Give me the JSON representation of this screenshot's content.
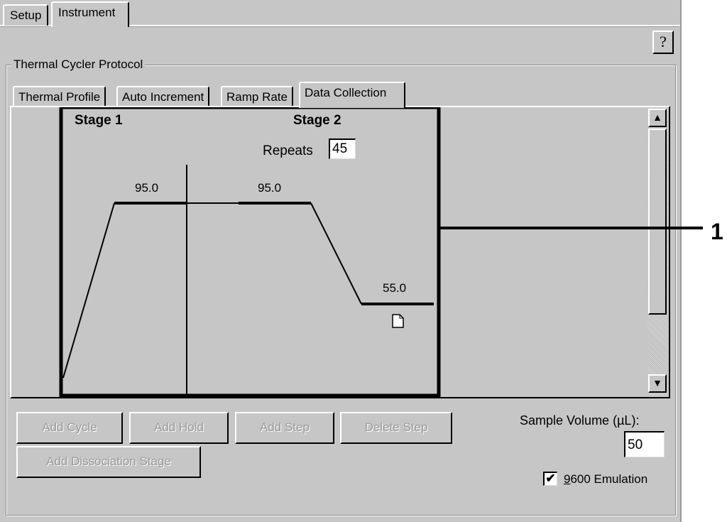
{
  "top_tabs": [
    {
      "label": "Setup",
      "active": false
    },
    {
      "label": "Instrument",
      "active": true
    }
  ],
  "help_button": {
    "label": "?"
  },
  "group": {
    "title": "Thermal Cycler Protocol"
  },
  "sub_tabs": [
    {
      "label": "Thermal Profile",
      "active": false
    },
    {
      "label": "Auto Increment",
      "active": false
    },
    {
      "label": "Ramp Rate",
      "active": false
    },
    {
      "label": "Data Collection",
      "active": true
    }
  ],
  "profile": {
    "stages": [
      {
        "label": "Stage 1",
        "steps": [
          {
            "temp": "95.0"
          }
        ]
      },
      {
        "label": "Stage 2",
        "repeats_label": "Repeats",
        "repeats": "45",
        "steps": [
          {
            "temp": "95.0"
          },
          {
            "temp": "55.0",
            "data_collection": true
          }
        ]
      }
    ]
  },
  "scrollbar": {
    "up_icon": "▲",
    "down_icon": "▼"
  },
  "buttons": {
    "add_cycle": "Add Cycle",
    "add_hold": "Add Hold",
    "add_step": "Add Step",
    "delete_step": "Delete Step",
    "add_dissociation": "Add Dissociation Stage"
  },
  "sample_volume": {
    "label": "Sample Volume (µL):",
    "value": "50"
  },
  "emulation": {
    "label_underlined": "9",
    "label_rest": "600 Emulation",
    "checked": true,
    "check_glyph": "✔"
  },
  "callout": {
    "label": "1"
  }
}
